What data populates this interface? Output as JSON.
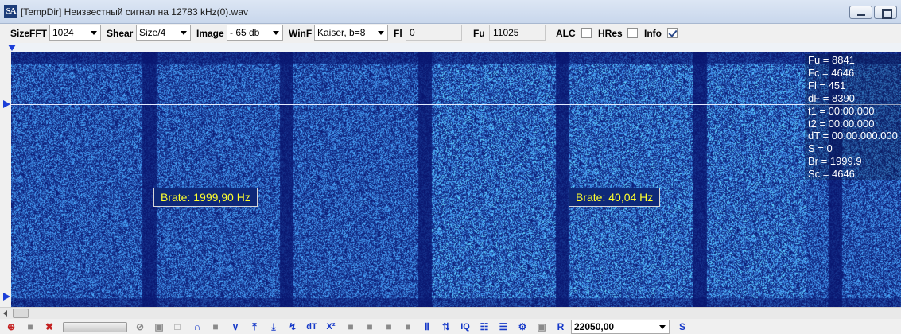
{
  "window": {
    "app_icon_text": "SA",
    "title": "[TempDir] Неизвестный сигнал на 12783 kHz(0).wav"
  },
  "toolbar": {
    "sizefft_label": "SizeFFT",
    "sizefft_value": "1024",
    "shear_label": "Shear",
    "shear_value": "Size/4",
    "image_label": "Image",
    "image_value": "- 65 db",
    "winf_label": "WinF",
    "winf_value": "Kaiser, b=8",
    "fl_label": "Fl",
    "fl_value": "0",
    "fu_label": "Fu",
    "fu_value": "11025",
    "alc_label": "ALC",
    "alc_checked": false,
    "hres_label": "HRes",
    "hres_checked": false,
    "info_label": "Info",
    "info_checked": true
  },
  "spectrogram": {
    "background_color": "#0a1676",
    "bright_color": "#2aa0ff",
    "cursor_line_color": "#e6ecff",
    "brate_left": "Brate: 1999,90 Hz",
    "brate_right": "Brate: 40,04 Hz"
  },
  "info_panel": [
    "Fu = 8841",
    "Fc = 4646",
    "Fl = 451",
    "dF = 8390",
    "t1 = 00:00.000",
    "t2 = 00:00.000",
    "dT = 00:00.000.000",
    "S = 0",
    "Br = 1999.9",
    "Sc = 4646"
  ],
  "bottom_toolbar": {
    "icons": [
      "zoom-icon",
      "record-icon",
      "delete-icon",
      "no-entry-icon",
      "copy-icon",
      "frame-icon",
      "wave-icon",
      "stop-icon",
      "v-shape-icon",
      "up-arrows-icon",
      "down-arrows-icon",
      "merge-arrows-icon",
      "dt-icon",
      "x-squared-icon",
      "block-icon",
      "bars-icon",
      "updown-icon",
      "iq-icon",
      "pattern-icon",
      "pattern2-icon",
      "gear-icon",
      "doc-icon",
      "r-icon",
      "s-icon"
    ],
    "frequency_value": "22050,00",
    "dt_label": "dT",
    "x2_label": "X²",
    "iq_label": "IQ",
    "r_label": "R",
    "s_label": "S"
  }
}
